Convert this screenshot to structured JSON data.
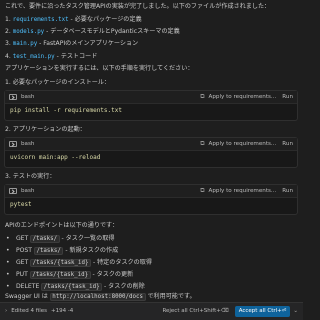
{
  "intro": "これで、要件に沿ったタスク管理APIの実装が完了しました。以下のファイルが作成されました：",
  "files": [
    {
      "num": "1.",
      "name": "requirements.txt",
      "desc": "- 必要なパッケージの定義"
    },
    {
      "num": "2.",
      "name": "models.py",
      "desc": "- データベースモデルとPydanticスキーマの定義"
    },
    {
      "num": "3.",
      "name": "main.py",
      "desc": "- FastAPIのメインアプリケーション"
    },
    {
      "num": "4.",
      "name": "test_main.py",
      "desc": "- テストコード"
    }
  ],
  "run_intro": "アプリケーションを実行するには、以下の手順を実行してください：",
  "steps": [
    {
      "label": "1. 必要なパッケージのインストール：",
      "lang": "bash",
      "apply": "Apply to requirements...",
      "run": "Run",
      "cmd": "pip install -r requirements.txt"
    },
    {
      "label": "2. アプリケーションの起動：",
      "lang": "bash",
      "apply": "Apply to requirements...",
      "run": "Run",
      "cmd": "uvicorn main:app --reload"
    },
    {
      "label": "3. テストの実行：",
      "lang": "bash",
      "apply": "Apply to requirements...",
      "run": "Run",
      "cmd": "pytest"
    }
  ],
  "endpoints_intro": "APIのエンドポイントは以下の通りです：",
  "endpoints": [
    {
      "method": "GET",
      "path": "/tasks/",
      "desc": "- タスク一覧の取得"
    },
    {
      "method": "POST",
      "path": "/tasks/",
      "desc": "- 新規タスクの作成"
    },
    {
      "method": "GET",
      "path": "/tasks/{task_id}",
      "desc": "- 特定のタスクの取得"
    },
    {
      "method": "PUT",
      "path": "/tasks/{task_id}",
      "desc": "- タスクの更新"
    },
    {
      "method": "DELETE",
      "path": "/tasks/{task_id}",
      "desc": "- タスクの削除"
    }
  ],
  "swagger": {
    "prefix": "Swagger UI は",
    "url": "http://localhost:8000/docs",
    "suffix": "で利用可能です。"
  },
  "bottom": {
    "edited": "Edited 4 files",
    "diff": "+194 -4",
    "reject": "Reject all Ctrl+Shift+⌫",
    "accept": "Accept all",
    "accept_shortcut": "Ctrl+⏎"
  },
  "colors": {
    "code": "#4fc1ff",
    "cmd": "#dcdcaa",
    "accept_bg": "#0e639c"
  }
}
